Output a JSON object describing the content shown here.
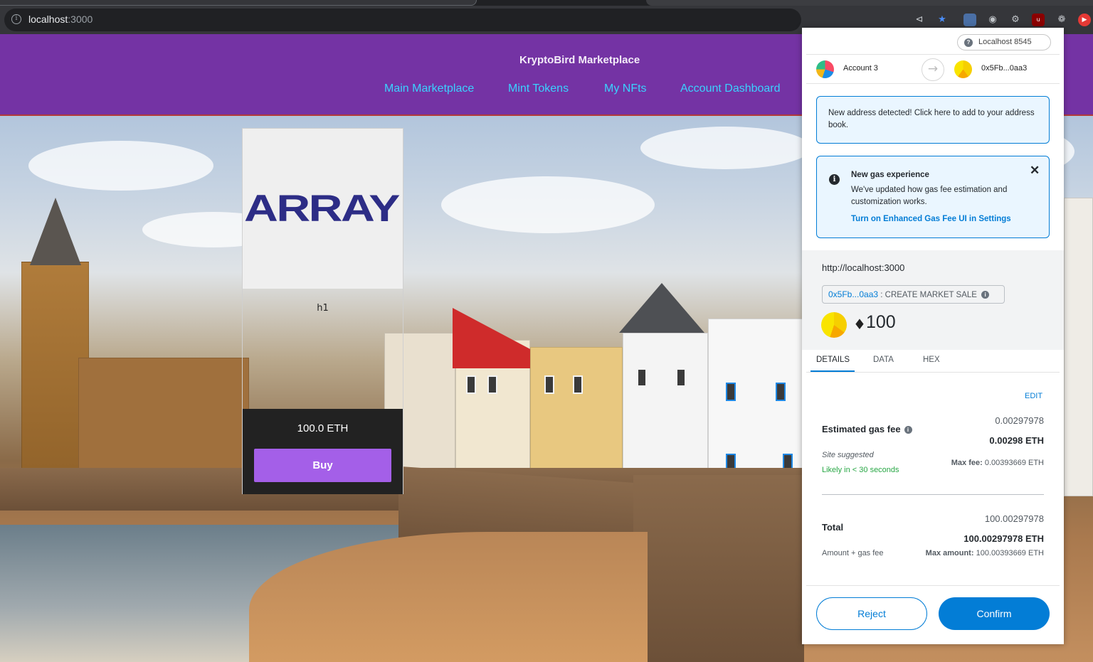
{
  "browser": {
    "url_host": "localhost",
    "url_port": ":3000"
  },
  "navbar": {
    "brand": "KryptoBird Marketplace",
    "links": [
      "Main Marketplace",
      "Mint Tokens",
      "My NFts",
      "Account Dashboard"
    ],
    "background": "#7433a4",
    "link_color": "#3ad2ff"
  },
  "nft_card": {
    "image_text": "ARRAY",
    "name": "h1",
    "price": "100.0 ETH",
    "buy_label": "Buy"
  },
  "metamask": {
    "network": "Localhost 8545",
    "from_account": "Account 3",
    "to_address": "0x5Fb...0aa3",
    "address_notice": "New address detected! Click here to add to your address book.",
    "gas_notice": {
      "title": "New gas experience",
      "body": "We've updated how gas fee estimation and customization works.",
      "link": "Turn on Enhanced Gas Fee UI in Settings"
    },
    "origin": "http://localhost:3000",
    "method_address": "0x5Fb...0aa3",
    "method_name": ": CREATE MARKET SALE",
    "amount": "100",
    "tabs": [
      "DETAILS",
      "DATA",
      "HEX"
    ],
    "edit_label": "EDIT",
    "gas": {
      "label": "Estimated gas fee",
      "value_small": "0.00297978",
      "value_bold": "0.00298 ETH",
      "site_suggested": "Site suggested",
      "likely": "Likely in < 30 seconds",
      "max_fee_label": "Max fee:",
      "max_fee_value": "0.00393669 ETH"
    },
    "total": {
      "label": "Total",
      "value_small": "100.00297978",
      "value_bold": "100.00297978 ETH",
      "sub_label": "Amount + gas fee",
      "max_amount_label": "Max amount:",
      "max_amount_value": "100.00393669 ETH"
    },
    "reject_label": "Reject",
    "confirm_label": "Confirm",
    "accent": "#037dd6"
  }
}
